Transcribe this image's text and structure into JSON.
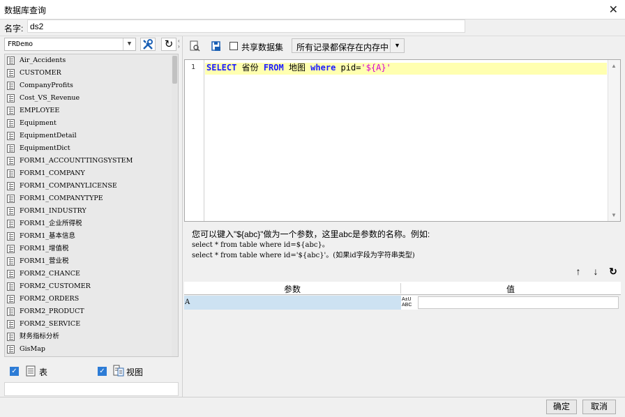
{
  "window": {
    "title": "数据库查询",
    "close_glyph": "✕"
  },
  "name_field": {
    "label": "名字:",
    "value": "ds2"
  },
  "database": {
    "selected": "FRDemo"
  },
  "tables": [
    "Air_Accidents",
    "CUSTOMER",
    "CompanyProfits",
    "Cost_VS_Revenue",
    "EMPLOYEE",
    "Equipment",
    "EquipmentDetail",
    "EquipmentDict",
    "FORM1_ACCOUNTTINGSYSTEM",
    "FORM1_COMPANY",
    "FORM1_COMPANYLICENSE",
    "FORM1_COMPANYTYPE",
    "FORM1_INDUSTRY",
    "FORM1_企业所得税",
    "FORM1_基本信息",
    "FORM1_增值税",
    "FORM1_营业税",
    "FORM2_CHANCE",
    "FORM2_CUSTOMER",
    "FORM2_ORDERS",
    "FORM2_PRODUCT",
    "FORM2_SERVICE",
    "财务指标分析",
    "GisMap"
  ],
  "filters": {
    "tables_label": "表",
    "views_label": "视图",
    "tables_checked": true,
    "views_checked": true
  },
  "toolbar": {
    "share_label": "共享数据集",
    "share_checked": false,
    "mode_selected": "所有记录都保存在内存中"
  },
  "editor": {
    "line_number": "1",
    "tokens": {
      "select": "SELECT",
      "t1": " 省份 ",
      "from": "FROM",
      "t2": " 地图 ",
      "where": "where",
      "t3": " pid=",
      "str": "'${A}'"
    }
  },
  "help": {
    "line1": "您可以键入\"${abc}\"做为一个参数，这里abc是参数的名称。例如:",
    "line2": "select * from table where id=${abc}。",
    "line3": "select * from table where id='${abc}'。(如果id字段为字符串类型)"
  },
  "params_table": {
    "col_param": "参数",
    "col_value": "值",
    "rows": [
      {
        "param": "A",
        "type_icon_top": "A±U",
        "type_icon_bottom": "ABC",
        "value": ""
      }
    ]
  },
  "buttons": {
    "ok": "确定",
    "cancel": "取消"
  }
}
